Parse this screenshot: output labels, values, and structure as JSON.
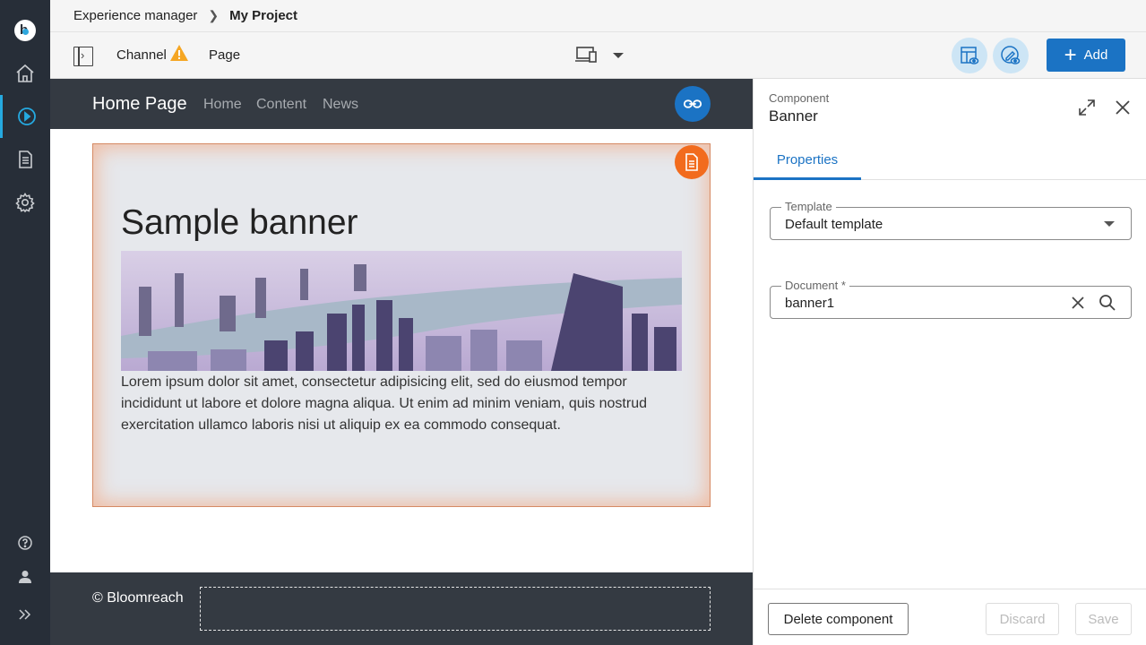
{
  "breadcrumb": {
    "root": "Experience manager",
    "current": "My Project"
  },
  "toolbar": {
    "channel_label": "Channel",
    "page_label": "Page",
    "add_label": "Add"
  },
  "site": {
    "brand": "Home Page",
    "nav": [
      "Home",
      "Content",
      "News"
    ],
    "footer_text": "© Bloomreach"
  },
  "banner": {
    "title": "Sample banner",
    "text": "Lorem ipsum dolor sit amet, consectetur adipisicing elit, sed do eiusmod tempor incididunt ut labore et dolore magna aliqua. Ut enim ad minim veniam, quis nostrud exercitation ullamco laboris nisi ut aliquip ex ea commodo consequat."
  },
  "panel": {
    "kicker": "Component",
    "title": "Banner",
    "tab": "Properties",
    "template_label": "Template",
    "template_value": "Default template",
    "document_label": "Document *",
    "document_value": "banner1",
    "delete_label": "Delete component",
    "discard_label": "Discard",
    "save_label": "Save"
  },
  "colors": {
    "accent": "#1b73c4",
    "rail": "#272e38",
    "site_dark": "#343a42",
    "highlight": "#f26b1d",
    "warning": "#f5a623"
  }
}
